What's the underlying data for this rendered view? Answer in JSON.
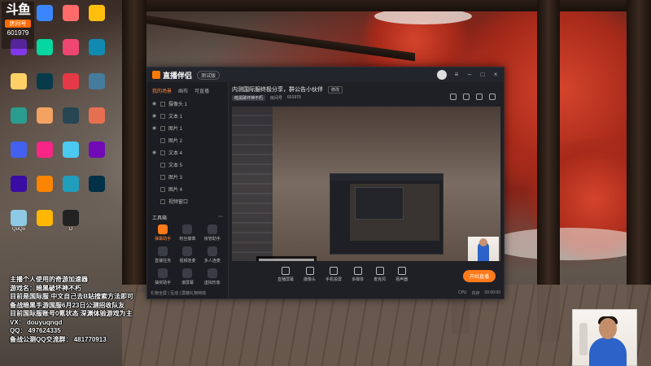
{
  "brand": {
    "logo_text": "斗鱼",
    "label": "房间号",
    "room_id": "601979"
  },
  "desktop_icons": [
    {
      "icon": "folder-icon",
      "color": "#e9c46a",
      "label": ""
    },
    {
      "icon": "app-icon",
      "color": "#3a86ff",
      "label": ""
    },
    {
      "icon": "app-icon",
      "color": "#ff6b6b",
      "label": ""
    },
    {
      "icon": "app-icon",
      "color": "#ffbe0b",
      "label": ""
    },
    {
      "icon": "app-icon",
      "color": "#8338ec",
      "label": ""
    },
    {
      "icon": "app-icon",
      "color": "#06d6a0",
      "label": ""
    },
    {
      "icon": "app-icon",
      "color": "#ef476f",
      "label": ""
    },
    {
      "icon": "app-icon",
      "color": "#118ab2",
      "label": ""
    },
    {
      "icon": "app-icon",
      "color": "#ffd166",
      "label": ""
    },
    {
      "icon": "app-icon",
      "color": "#073b4c",
      "label": ""
    },
    {
      "icon": "app-icon",
      "color": "#e63946",
      "label": ""
    },
    {
      "icon": "app-icon",
      "color": "#457b9d",
      "label": ""
    },
    {
      "icon": "app-icon",
      "color": "#2a9d8f",
      "label": ""
    },
    {
      "icon": "app-icon",
      "color": "#f4a261",
      "label": ""
    },
    {
      "icon": "app-icon",
      "color": "#264653",
      "label": ""
    },
    {
      "icon": "app-icon",
      "color": "#e76f51",
      "label": ""
    },
    {
      "icon": "app-icon",
      "color": "#4361ee",
      "label": ""
    },
    {
      "icon": "app-icon",
      "color": "#f72585",
      "label": ""
    },
    {
      "icon": "app-icon",
      "color": "#4cc9f0",
      "label": ""
    },
    {
      "icon": "app-icon",
      "color": "#7209b7",
      "label": ""
    },
    {
      "icon": "app-icon",
      "color": "#3a0ca3",
      "label": ""
    },
    {
      "icon": "app-icon",
      "color": "#fb8500",
      "label": ""
    },
    {
      "icon": "app-icon",
      "color": "#219ebc",
      "label": ""
    },
    {
      "icon": "app-icon",
      "color": "#023047",
      "label": ""
    },
    {
      "icon": "app-icon",
      "color": "#8ecae6",
      "label": "QuQu"
    },
    {
      "icon": "app-icon",
      "color": "#ffb703",
      "label": ""
    },
    {
      "icon": "app-icon",
      "color": "#222222",
      "label": "D"
    }
  ],
  "app": {
    "title": "直播伴侣",
    "version": "测试版",
    "left_tabs": [
      "我的场景",
      "画布",
      "可直播"
    ],
    "scenes": [
      {
        "name": "摄像头 1",
        "visible": true
      },
      {
        "name": "文本 1",
        "visible": true
      },
      {
        "name": "图片 1",
        "visible": true
      },
      {
        "name": "图片 2",
        "visible": false
      },
      {
        "name": "文本 4",
        "visible": true
      },
      {
        "name": "文本 5",
        "visible": false
      },
      {
        "name": "图片 3",
        "visible": false
      },
      {
        "name": "图片 4",
        "visible": false
      },
      {
        "name": "视频窗口",
        "visible": false
      }
    ],
    "tools_title": "工具箱",
    "tools": [
      {
        "label": "弹幕助手",
        "highlight": true
      },
      {
        "label": "粉丝徽章",
        "highlight": false
      },
      {
        "label": "房管助手",
        "highlight": false
      },
      {
        "label": "直播任务",
        "highlight": false
      },
      {
        "label": "视频连麦",
        "highlight": false
      },
      {
        "label": "多人连麦",
        "highlight": false
      },
      {
        "label": "抽奖助手",
        "highlight": false
      },
      {
        "label": "滚屏幕",
        "highlight": false
      },
      {
        "label": "虚拟形象",
        "highlight": false
      }
    ],
    "room_title": "内测国际服终极分享，群公告小伙伴",
    "room_tag": "修改",
    "room_category": "暗黑破坏神不朽",
    "room_meta": "房间号",
    "room_id": "601979",
    "bottom_tools": [
      "直播屏幕",
      "摄像头",
      "手机投屏",
      "多媒体",
      "麦克风",
      "扬声器"
    ],
    "start_button": "开始直播",
    "status_left": "礼物全屏 | 互动 | 屏蔽礼物特效",
    "status_right": [
      "CPU",
      "内存",
      "00:00:00"
    ]
  },
  "info_lines": [
    "主播个人使用的奇游加速器",
    "游戏名：暗黑破坏神不朽",
    "目前是国际服  中文自己去B站搜索方法即可",
    "备战暗黑手游国服6月23日公测招收队友",
    "目前国际服账号0氪状态  深渊体验游戏为主",
    "VX： douyuqnqd",
    "QQ：  497624335",
    "备战公测QQ交流群：  481770913"
  ]
}
